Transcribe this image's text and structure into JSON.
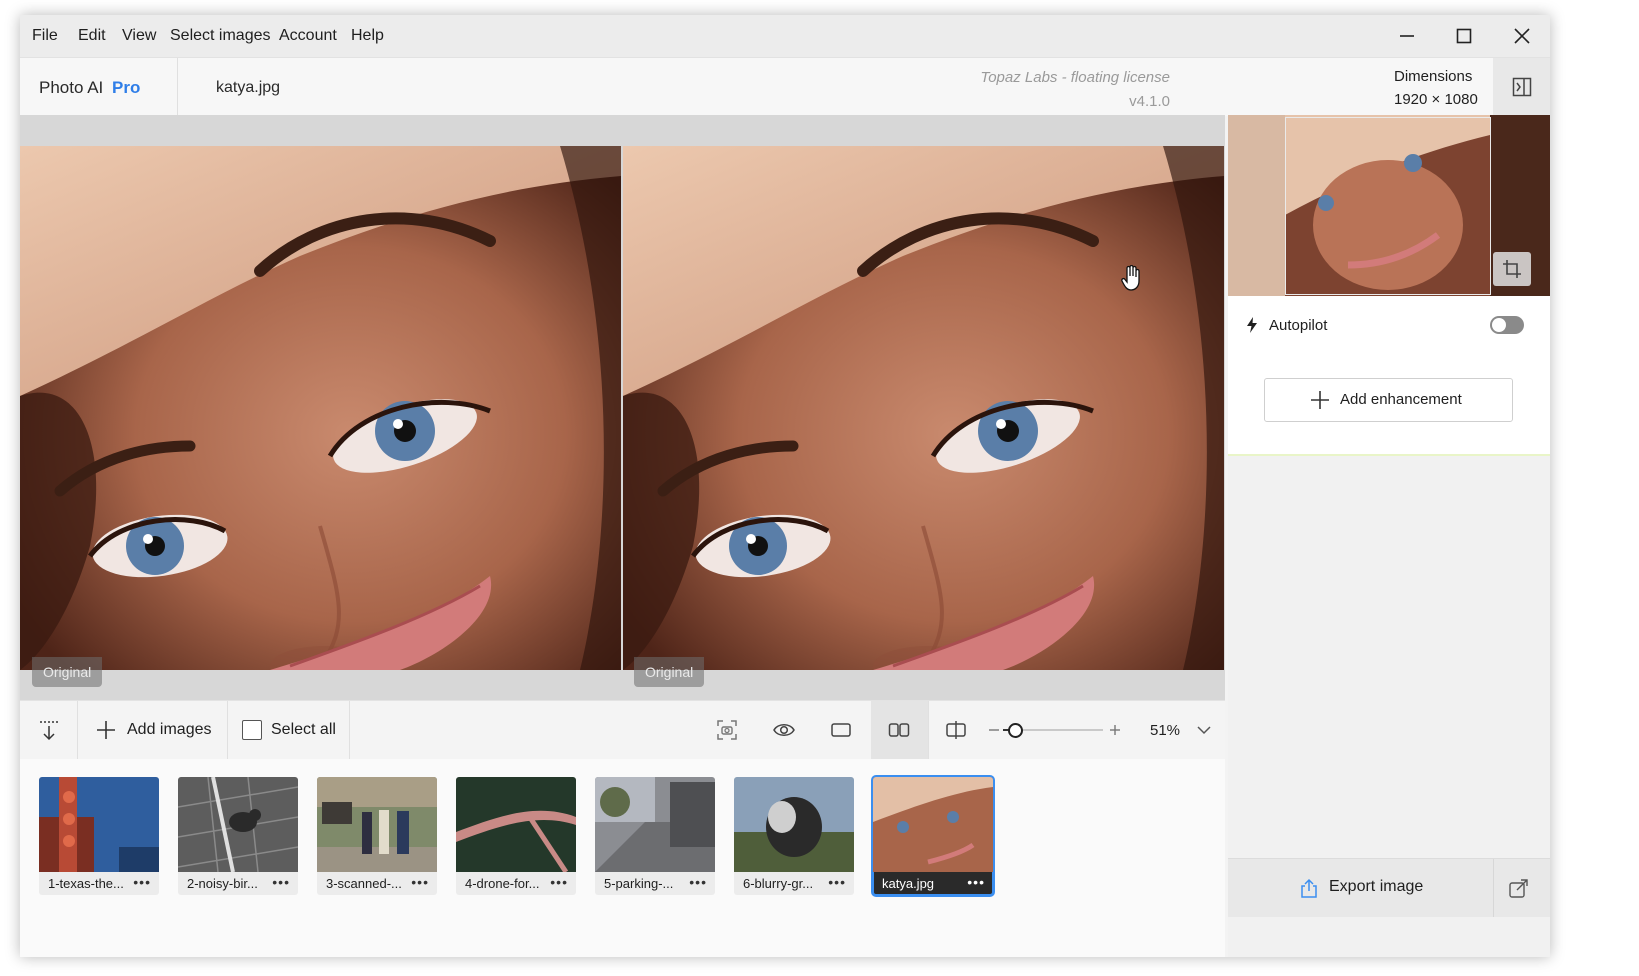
{
  "menu": {
    "items": [
      "File",
      "Edit",
      "View",
      "Select images",
      "Account",
      "Help"
    ]
  },
  "window_controls": [
    "minimize-icon",
    "maximize-icon",
    "close-icon"
  ],
  "header": {
    "app_name": "Photo AI",
    "edition": "Pro",
    "filename": "katya.jpg",
    "license": "Topaz Labs - floating license",
    "version": "v4.1.0",
    "dimensions_label": "Dimensions",
    "dimensions_value": "1920 × 1080"
  },
  "canvas": {
    "left_label": "Original",
    "right_label": "Original"
  },
  "toolbar": {
    "add_images": "Add images",
    "select_all": "Select all",
    "select_all_checked": false,
    "zoom": "51%",
    "zoom_level_fraction": 0.08,
    "view_modes": [
      "screenshot-icon",
      "eye-icon",
      "single-view-icon",
      "side-by-side-icon",
      "split-view-icon"
    ],
    "active_view": "side-by-side"
  },
  "filmstrip": {
    "items": [
      {
        "name": "1-texas-the...",
        "selected": false
      },
      {
        "name": "2-noisy-bir...",
        "selected": false
      },
      {
        "name": "3-scanned-...",
        "selected": false
      },
      {
        "name": "4-drone-for...",
        "selected": false
      },
      {
        "name": "5-parking-...",
        "selected": false
      },
      {
        "name": "6-blurry-gr...",
        "selected": false
      },
      {
        "name": "katya.jpg",
        "selected": true
      }
    ],
    "menu_glyph": "•••"
  },
  "sidebar": {
    "autopilot_label": "Autopilot",
    "autopilot_on": false,
    "add_enhancement": "Add enhancement",
    "export": "Export image"
  },
  "colors": {
    "accent": "#2f7ee8",
    "selected_outline": "#3a8ef0"
  }
}
